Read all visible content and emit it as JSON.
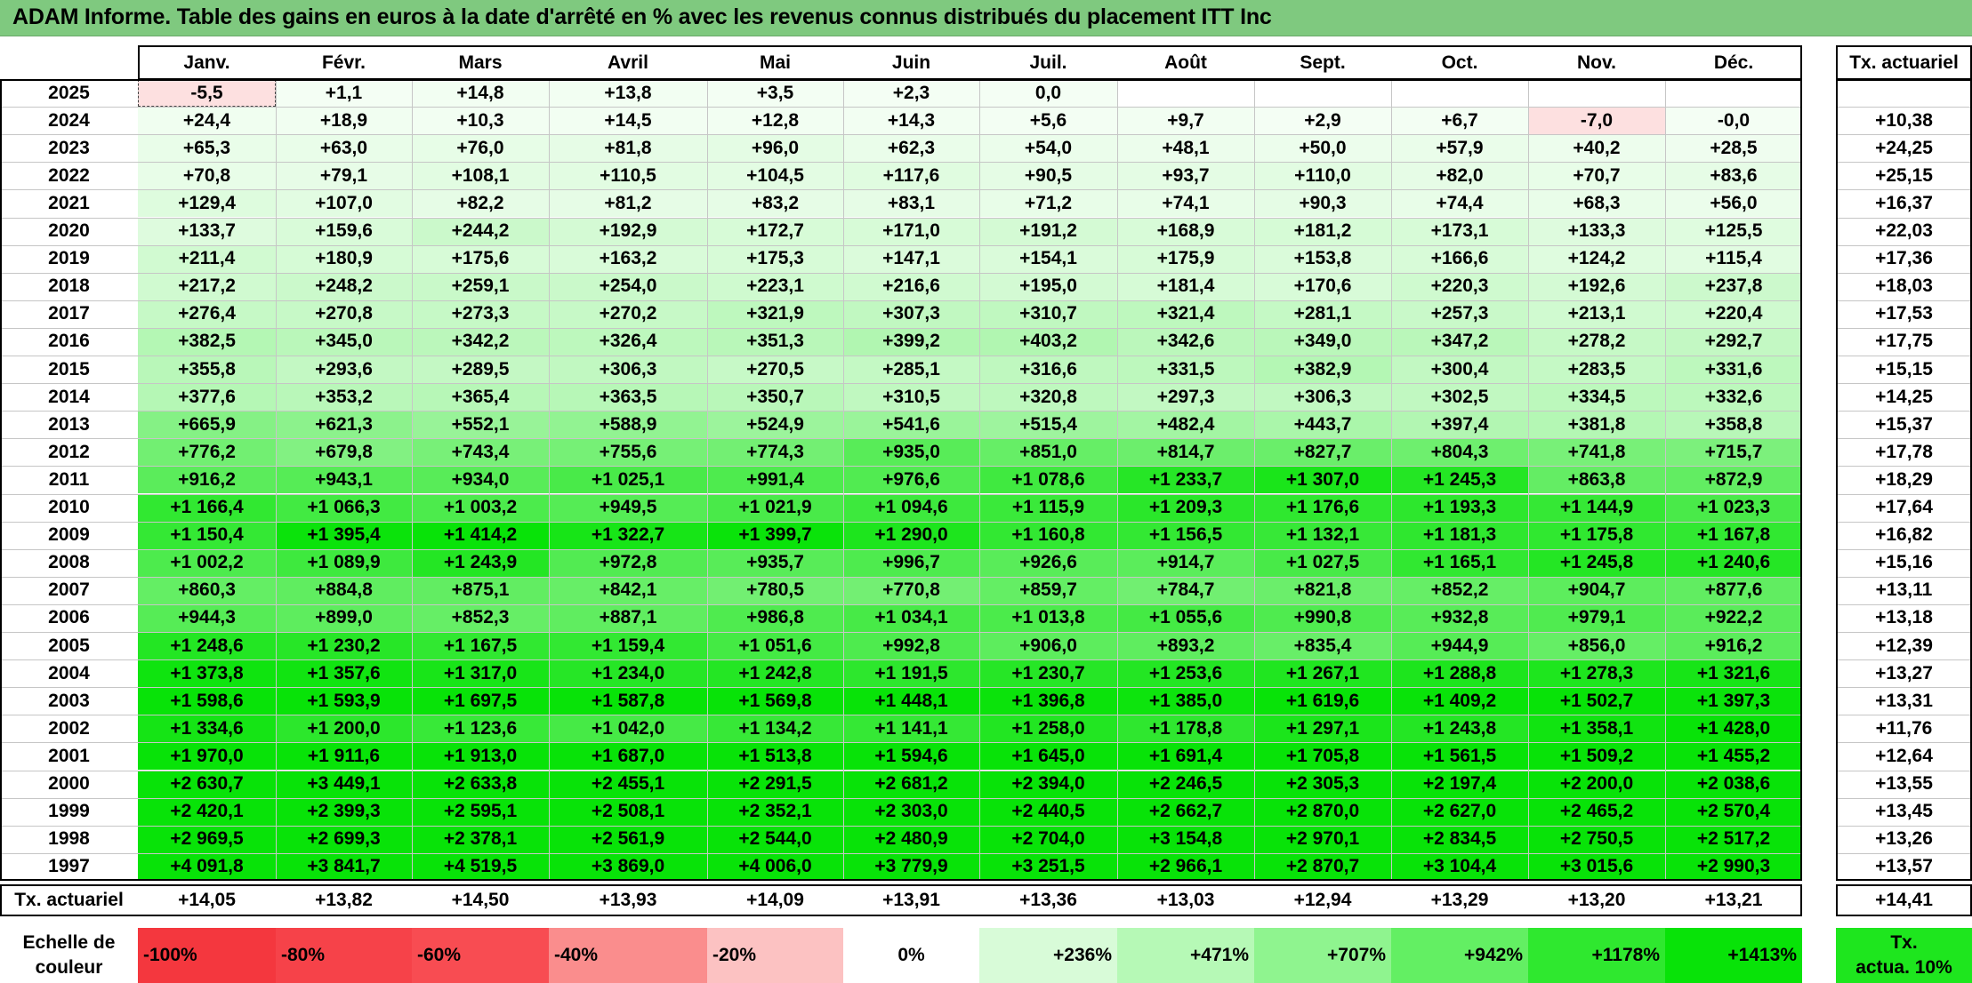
{
  "title": "ADAM Informe. Table des gains en euros à la date d'arrêté en % avec les revenus connus distribués du placement ITT Inc",
  "months": [
    "Janv.",
    "Févr.",
    "Mars",
    "Avril",
    "Mai",
    "Juin",
    "Juil.",
    "Août",
    "Sept.",
    "Oct.",
    "Nov.",
    "Déc."
  ],
  "rate_header": "Tx. actuariel",
  "footer_label": "Tx. actuariel",
  "rows": [
    {
      "year": "2025",
      "cells": [
        "-5,5",
        "+1,1",
        "+14,8",
        "+13,8",
        "+3,5",
        "+2,3",
        "0,0",
        "",
        "",
        "",
        "",
        ""
      ],
      "rate": ""
    },
    {
      "year": "2024",
      "cells": [
        "+24,4",
        "+18,9",
        "+10,3",
        "+14,5",
        "+12,8",
        "+14,3",
        "+5,6",
        "+9,7",
        "+2,9",
        "+6,7",
        "-7,0",
        "-0,0"
      ],
      "rate": "+10,38"
    },
    {
      "year": "2023",
      "cells": [
        "+65,3",
        "+63,0",
        "+76,0",
        "+81,8",
        "+96,0",
        "+62,3",
        "+54,0",
        "+48,1",
        "+50,0",
        "+57,9",
        "+40,2",
        "+28,5"
      ],
      "rate": "+24,25"
    },
    {
      "year": "2022",
      "cells": [
        "+70,8",
        "+79,1",
        "+108,1",
        "+110,5",
        "+104,5",
        "+117,6",
        "+90,5",
        "+93,7",
        "+110,0",
        "+82,0",
        "+70,7",
        "+83,6"
      ],
      "rate": "+25,15"
    },
    {
      "year": "2021",
      "cells": [
        "+129,4",
        "+107,0",
        "+82,2",
        "+81,2",
        "+83,2",
        "+83,1",
        "+71,2",
        "+74,1",
        "+90,3",
        "+74,4",
        "+68,3",
        "+56,0"
      ],
      "rate": "+16,37"
    },
    {
      "year": "2020",
      "cells": [
        "+133,7",
        "+159,6",
        "+244,2",
        "+192,9",
        "+172,7",
        "+171,0",
        "+191,2",
        "+168,9",
        "+181,2",
        "+173,1",
        "+133,3",
        "+125,5"
      ],
      "rate": "+22,03"
    },
    {
      "year": "2019",
      "cells": [
        "+211,4",
        "+180,9",
        "+175,6",
        "+163,2",
        "+175,3",
        "+147,1",
        "+154,1",
        "+175,9",
        "+153,8",
        "+166,6",
        "+124,2",
        "+115,4"
      ],
      "rate": "+17,36"
    },
    {
      "year": "2018",
      "cells": [
        "+217,2",
        "+248,2",
        "+259,1",
        "+254,0",
        "+223,1",
        "+216,6",
        "+195,0",
        "+181,4",
        "+170,6",
        "+220,3",
        "+192,6",
        "+237,8"
      ],
      "rate": "+18,03"
    },
    {
      "year": "2017",
      "cells": [
        "+276,4",
        "+270,8",
        "+273,3",
        "+270,2",
        "+321,9",
        "+307,3",
        "+310,7",
        "+321,4",
        "+281,1",
        "+257,3",
        "+213,1",
        "+220,4"
      ],
      "rate": "+17,53"
    },
    {
      "year": "2016",
      "cells": [
        "+382,5",
        "+345,0",
        "+342,2",
        "+326,4",
        "+351,3",
        "+399,2",
        "+403,2",
        "+342,6",
        "+349,0",
        "+347,2",
        "+278,2",
        "+292,7"
      ],
      "rate": "+17,75"
    },
    {
      "year": "2015",
      "cells": [
        "+355,8",
        "+293,6",
        "+289,5",
        "+306,3",
        "+270,5",
        "+285,1",
        "+316,6",
        "+331,5",
        "+382,9",
        "+300,4",
        "+283,5",
        "+331,6"
      ],
      "rate": "+15,15"
    },
    {
      "year": "2014",
      "cells": [
        "+377,6",
        "+353,2",
        "+365,4",
        "+363,5",
        "+350,7",
        "+310,5",
        "+320,8",
        "+297,3",
        "+306,3",
        "+302,5",
        "+334,5",
        "+332,6"
      ],
      "rate": "+14,25"
    },
    {
      "year": "2013",
      "cells": [
        "+665,9",
        "+621,3",
        "+552,1",
        "+588,9",
        "+524,9",
        "+541,6",
        "+515,4",
        "+482,4",
        "+443,7",
        "+397,4",
        "+381,8",
        "+358,8"
      ],
      "rate": "+15,37"
    },
    {
      "year": "2012",
      "cells": [
        "+776,2",
        "+679,8",
        "+743,4",
        "+755,6",
        "+774,3",
        "+935,0",
        "+851,0",
        "+814,7",
        "+827,7",
        "+804,3",
        "+741,8",
        "+715,7"
      ],
      "rate": "+17,78"
    },
    {
      "year": "2011",
      "cells": [
        "+916,2",
        "+943,1",
        "+934,0",
        "+1 025,1",
        "+991,4",
        "+976,6",
        "+1 078,6",
        "+1 233,7",
        "+1 307,0",
        "+1 245,3",
        "+863,8",
        "+872,9"
      ],
      "rate": "+18,29"
    },
    {
      "year": "2010",
      "cells": [
        "+1 166,4",
        "+1 066,3",
        "+1 003,2",
        "+949,5",
        "+1 021,9",
        "+1 094,6",
        "+1 115,9",
        "+1 209,3",
        "+1 176,6",
        "+1 193,3",
        "+1 144,9",
        "+1 023,3"
      ],
      "rate": "+17,64"
    },
    {
      "year": "2009",
      "cells": [
        "+1 150,4",
        "+1 395,4",
        "+1 414,2",
        "+1 322,7",
        "+1 399,7",
        "+1 290,0",
        "+1 160,8",
        "+1 156,5",
        "+1 132,1",
        "+1 181,3",
        "+1 175,8",
        "+1 167,8"
      ],
      "rate": "+16,82"
    },
    {
      "year": "2008",
      "cells": [
        "+1 002,2",
        "+1 089,9",
        "+1 243,9",
        "+972,8",
        "+935,7",
        "+996,7",
        "+926,6",
        "+914,7",
        "+1 027,5",
        "+1 165,1",
        "+1 245,8",
        "+1 240,6"
      ],
      "rate": "+15,16"
    },
    {
      "year": "2007",
      "cells": [
        "+860,3",
        "+884,8",
        "+875,1",
        "+842,1",
        "+780,5",
        "+770,8",
        "+859,7",
        "+784,7",
        "+821,8",
        "+852,2",
        "+904,7",
        "+877,6"
      ],
      "rate": "+13,11"
    },
    {
      "year": "2006",
      "cells": [
        "+944,3",
        "+899,0",
        "+852,3",
        "+887,1",
        "+986,8",
        "+1 034,1",
        "+1 013,8",
        "+1 055,6",
        "+990,8",
        "+932,8",
        "+979,1",
        "+922,2"
      ],
      "rate": "+13,18"
    },
    {
      "year": "2005",
      "cells": [
        "+1 248,6",
        "+1 230,2",
        "+1 167,5",
        "+1 159,4",
        "+1 051,6",
        "+992,8",
        "+906,0",
        "+893,2",
        "+835,4",
        "+944,9",
        "+856,0",
        "+916,2"
      ],
      "rate": "+12,39"
    },
    {
      "year": "2004",
      "cells": [
        "+1 373,8",
        "+1 357,6",
        "+1 317,0",
        "+1 234,0",
        "+1 242,8",
        "+1 191,5",
        "+1 230,7",
        "+1 253,6",
        "+1 267,1",
        "+1 288,8",
        "+1 278,3",
        "+1 321,6"
      ],
      "rate": "+13,27"
    },
    {
      "year": "2003",
      "cells": [
        "+1 598,6",
        "+1 593,9",
        "+1 697,5",
        "+1 587,8",
        "+1 569,8",
        "+1 448,1",
        "+1 396,8",
        "+1 385,0",
        "+1 619,6",
        "+1 409,2",
        "+1 502,7",
        "+1 397,3"
      ],
      "rate": "+13,31"
    },
    {
      "year": "2002",
      "cells": [
        "+1 334,6",
        "+1 200,0",
        "+1 123,6",
        "+1 042,0",
        "+1 134,2",
        "+1 141,1",
        "+1 258,0",
        "+1 178,8",
        "+1 297,1",
        "+1 243,8",
        "+1 358,1",
        "+1 428,0"
      ],
      "rate": "+11,76"
    },
    {
      "year": "2001",
      "cells": [
        "+1 970,0",
        "+1 911,6",
        "+1 913,0",
        "+1 687,0",
        "+1 513,8",
        "+1 594,6",
        "+1 645,0",
        "+1 691,4",
        "+1 705,8",
        "+1 561,5",
        "+1 509,2",
        "+1 455,2"
      ],
      "rate": "+12,64"
    },
    {
      "year": "2000",
      "cells": [
        "+2 630,7",
        "+3 449,1",
        "+2 633,8",
        "+2 455,1",
        "+2 291,5",
        "+2 681,2",
        "+2 394,0",
        "+2 246,5",
        "+2 305,3",
        "+2 197,4",
        "+2 200,0",
        "+2 038,6"
      ],
      "rate": "+13,55"
    },
    {
      "year": "1999",
      "cells": [
        "+2 420,1",
        "+2 399,3",
        "+2 595,1",
        "+2 508,1",
        "+2 352,1",
        "+2 303,0",
        "+2 440,5",
        "+2 662,7",
        "+2 870,0",
        "+2 627,0",
        "+2 465,2",
        "+2 570,4"
      ],
      "rate": "+13,45"
    },
    {
      "year": "1998",
      "cells": [
        "+2 969,5",
        "+2 699,3",
        "+2 378,1",
        "+2 561,9",
        "+2 544,0",
        "+2 480,9",
        "+2 704,0",
        "+3 154,8",
        "+2 970,1",
        "+2 834,5",
        "+2 750,5",
        "+2 517,2"
      ],
      "rate": "+13,26"
    },
    {
      "year": "1997",
      "cells": [
        "+4 091,8",
        "+3 841,7",
        "+4 519,5",
        "+3 869,0",
        "+4 006,0",
        "+3 779,9",
        "+3 251,5",
        "+2 966,1",
        "+2 870,7",
        "+3 104,4",
        "+3 015,6",
        "+2 990,3"
      ],
      "rate": "+13,57"
    }
  ],
  "footer": [
    "+14,05",
    "+13,82",
    "+14,50",
    "+13,93",
    "+14,09",
    "+13,91",
    "+13,36",
    "+13,03",
    "+12,94",
    "+13,29",
    "+13,20",
    "+13,21"
  ],
  "footer_rate": "+14,41",
  "legend": {
    "label_line1": "Echelle de",
    "label_line2": "couleur",
    "items": [
      {
        "text": "-100%",
        "color": "#f4373e",
        "align": "left"
      },
      {
        "text": "-80%",
        "color": "#f64249",
        "align": "left"
      },
      {
        "text": "-60%",
        "color": "#f84c52",
        "align": "left"
      },
      {
        "text": "-40%",
        "color": "#fa8d8d",
        "align": "left"
      },
      {
        "text": "-20%",
        "color": "#fcc2c2",
        "align": "left"
      },
      {
        "text": "0%",
        "color": "#ffffff",
        "align": "center"
      },
      {
        "text": "+236%",
        "color": "#d8fbd8",
        "align": "right"
      },
      {
        "text": "+471%",
        "color": "#b6f9b6",
        "align": "right"
      },
      {
        "text": "+707%",
        "color": "#8ff48f",
        "align": "right"
      },
      {
        "text": "+942%",
        "color": "#63ef63",
        "align": "right"
      },
      {
        "text": "+1178%",
        "color": "#2fe82f",
        "align": "right"
      },
      {
        "text": "+1413%",
        "color": "#08e308",
        "align": "right"
      }
    ],
    "rate_line1": "Tx.",
    "rate_line2": "actua. 10%",
    "rate_color": "#1ee61e"
  },
  "colors": {
    "title_bg": "#7fc97f",
    "negative_bg": "#fde0e0",
    "grid_line": "#c6c6c6"
  }
}
